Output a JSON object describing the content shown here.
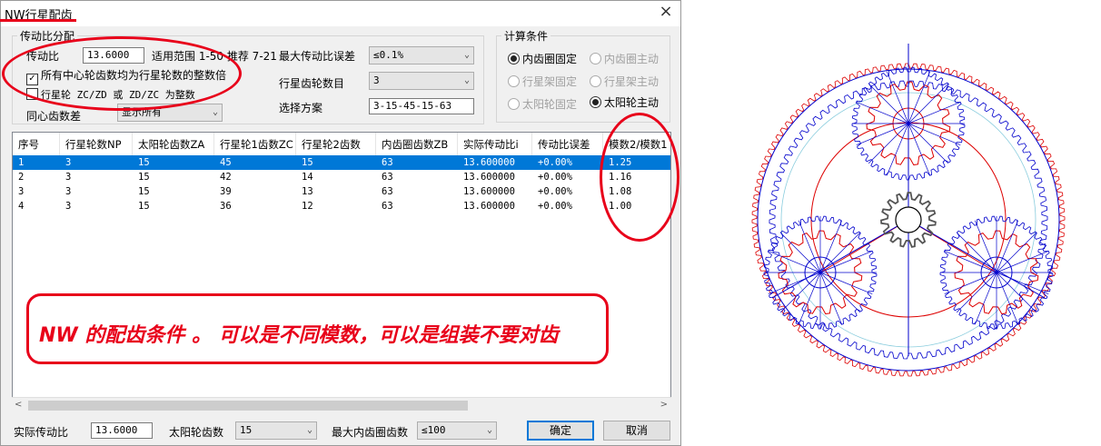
{
  "window": {
    "title": "NW行星配齿",
    "close": "×"
  },
  "ratio_group": {
    "caption": "传动比分配",
    "ratio_label": "传动比",
    "ratio_value": "13.6000",
    "range_text": "适用范围 1-50 推荐 7-21",
    "max_err_label": "最大传动比误差",
    "max_err_value": "≤0.1%",
    "chk_integer_label": "所有中心轮齿数均为行星轮数的整数倍",
    "chk_planet_label": "行星轮 ZC/ZD 或 ZD/ZC 为整数",
    "coax_label": "同心齿数差",
    "coax_value": "显示所有",
    "planet_count_label": "行星齿轮数目",
    "planet_count_value": "3",
    "scheme_label": "选择方案",
    "scheme_value": "3-15-45-15-63"
  },
  "calc_group": {
    "caption": "计算条件",
    "options": [
      {
        "label": "内齿圈固定",
        "state": "on"
      },
      {
        "label": "内齿圈主动",
        "state": "disabled"
      },
      {
        "label": "行星架固定",
        "state": "disabled"
      },
      {
        "label": "行星架主动",
        "state": "disabled"
      },
      {
        "label": "太阳轮固定",
        "state": "disabled"
      },
      {
        "label": "太阳轮主动",
        "state": "on"
      }
    ]
  },
  "table": {
    "columns": [
      "序号",
      "行星轮数NP",
      "太阳轮齿数ZA",
      "行星轮1齿数ZC",
      "行星轮2齿数ZD",
      "内齿圈齿数ZB",
      "实际传动比i",
      "传动比误差",
      "模数2/模数1"
    ],
    "rows": [
      [
        "1",
        "3",
        "15",
        "45",
        "15",
        "63",
        "13.600000",
        "+0.00%",
        "1.25"
      ],
      [
        "2",
        "3",
        "15",
        "42",
        "14",
        "63",
        "13.600000",
        "+0.00%",
        "1.16"
      ],
      [
        "3",
        "3",
        "15",
        "39",
        "13",
        "63",
        "13.600000",
        "+0.00%",
        "1.08"
      ],
      [
        "4",
        "3",
        "15",
        "36",
        "12",
        "63",
        "13.600000",
        "+0.00%",
        "1.00"
      ]
    ],
    "selected_row": 0
  },
  "bottom": {
    "actual_ratio_label": "实际传动比",
    "actual_ratio_value": "13.6000",
    "sun_teeth_label": "太阳轮齿数",
    "sun_teeth_value": "15",
    "max_ring_label": "最大内齿圈齿数",
    "max_ring_value": "≤100",
    "ok_label": "确定",
    "cancel_label": "取消"
  },
  "annotation": {
    "text": "NW 的配齿条件 。 可以是不同模数，可以是组装不要对齿"
  },
  "colors": {
    "annotation": "#e8001a",
    "selection": "#0078d7",
    "gear_blue": "#0000cc",
    "gear_red": "#dd0000",
    "gear_gray": "#555555"
  }
}
